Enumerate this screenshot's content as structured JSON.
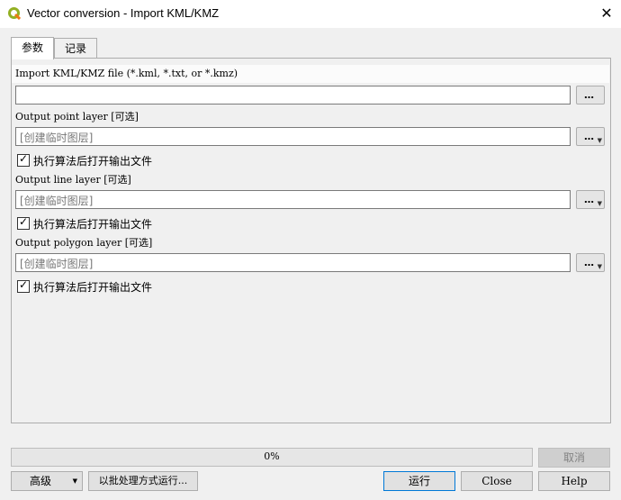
{
  "window": {
    "title": "Vector conversion - Import KML/KMZ",
    "close_glyph": "✕"
  },
  "tabs": [
    {
      "label": "参数"
    },
    {
      "label": "记录"
    }
  ],
  "params": {
    "input_label": "Import KML/KMZ file (*.kml, *.txt, or *.kmz)",
    "input_value": "",
    "point_label": "Output point layer [可选]",
    "point_placeholder": "[创建临时图层]",
    "point_open_label": "执行算法后打开输出文件",
    "line_label": "Output line layer [可选]",
    "line_placeholder": "[创建临时图层]",
    "line_open_label": "执行算法后打开输出文件",
    "polygon_label": "Output polygon layer [可选]",
    "polygon_placeholder": "[创建临时图层]",
    "polygon_open_label": "执行算法后打开输出文件",
    "browse_glyph": "…"
  },
  "footer": {
    "progress_text": "0%",
    "progress_fraction": 0,
    "cancel_label": "取消",
    "advanced_label": "高级",
    "batch_label": "以批处理方式运行...",
    "run_label": "运行",
    "close_label": "Close",
    "help_label": "Help"
  }
}
